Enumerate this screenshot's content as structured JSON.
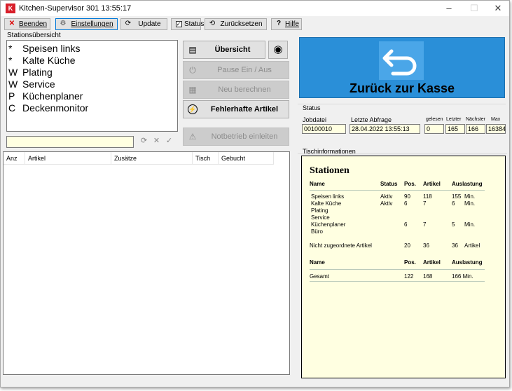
{
  "window": {
    "title": "Kitchen-Supervisor 301 13:55:17"
  },
  "toolbar": {
    "beenden": "Beenden",
    "einstellungen": "Einstellungen",
    "update": "Update",
    "status": "Status",
    "zuruecksetzen": "Zurücksetzen",
    "hilfe": "Hilfe",
    "hilfe_icon": "?"
  },
  "stations": {
    "label": "Stationsübersicht",
    "items": [
      {
        "prefix": "*",
        "name": "Speisen links"
      },
      {
        "prefix": "*",
        "name": "Kalte Küche"
      },
      {
        "prefix": "W",
        "name": "Plating"
      },
      {
        "prefix": "W",
        "name": "Service"
      },
      {
        "prefix": "P",
        "name": "Küchenplaner"
      },
      {
        "prefix": "C",
        "name": "Deckenmonitor"
      }
    ]
  },
  "actions": {
    "uebersicht": "Übersicht",
    "pause": "Pause Ein / Aus",
    "neu_berechnen": "Neu berechnen",
    "fehlerhafte": "Fehlerhafte Artikel",
    "notbetrieb": "Notbetrieb einleiten"
  },
  "grid": {
    "columns": [
      "Anz",
      "Artikel",
      "Zusätze",
      "Tisch",
      "Gebucht"
    ]
  },
  "kasse": {
    "label": "Zurück zur Kasse"
  },
  "status": {
    "label": "Status",
    "jobdatei_label": "Jobdatei",
    "jobdatei": "00100010",
    "letzte_label": "Letzte Abfrage",
    "letzte": "28.04.2022 13:55:13",
    "gelesen_label": "gelesen",
    "gelesen": "0",
    "letzter_label": "Letzter",
    "letzter": "165",
    "naechster_label": "Nächster",
    "naechster": "166",
    "max_label": "Max",
    "max": "16384"
  },
  "tischinfo": {
    "label": "Tischinformationen",
    "title": "Stationen",
    "headers": {
      "name": "Name",
      "status": "Status",
      "pos": "Pos.",
      "artikel": "Artikel",
      "auslastung": "Auslastung"
    },
    "rows": [
      {
        "name": "Speisen links",
        "status": "Aktiv",
        "pos": "90",
        "artikel": "118",
        "ausl": "155",
        "unit": "Min."
      },
      {
        "name": "Kalte Küche",
        "status": "Aktiv",
        "pos": "6",
        "artikel": "7",
        "ausl": "6",
        "unit": "Min."
      },
      {
        "name": "Plating",
        "status": "",
        "pos": "",
        "artikel": "",
        "ausl": "",
        "unit": ""
      },
      {
        "name": "Service",
        "status": "",
        "pos": "",
        "artikel": "",
        "ausl": "",
        "unit": ""
      },
      {
        "name": "Küchenplaner",
        "status": "",
        "pos": "6",
        "artikel": "7",
        "ausl": "5",
        "unit": "Min."
      },
      {
        "name": "Büro",
        "status": "",
        "pos": "",
        "artikel": "",
        "ausl": "",
        "unit": ""
      }
    ],
    "unassigned": {
      "name": "Nicht zugeordnete Artikel",
      "pos": "20",
      "artikel": "36",
      "ausl": "36",
      "unit": "Artikel"
    },
    "total": {
      "name": "Gesamt",
      "pos": "122",
      "artikel": "168",
      "ausl": "166 Min."
    }
  }
}
